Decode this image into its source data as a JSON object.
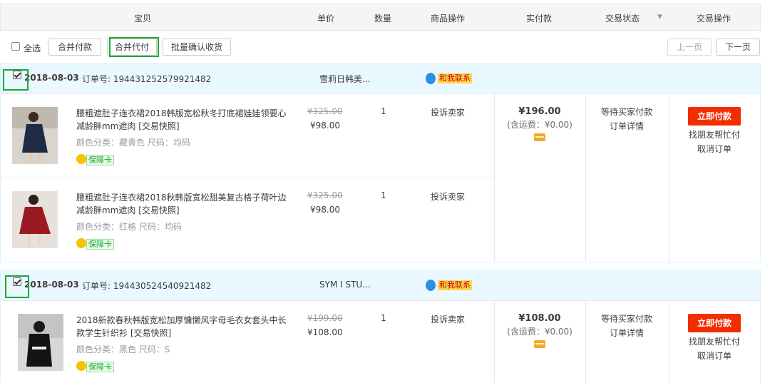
{
  "header": {
    "baby": "宝贝",
    "unit_price": "单价",
    "quantity": "数量",
    "product_ops": "商品操作",
    "paid": "实付款",
    "trade_status": "交易状态",
    "trade_ops": "交易操作"
  },
  "toolbar": {
    "select_all": "全选",
    "merge_pay": "合并付款",
    "merge_proxy_pay": "合并代付",
    "batch_confirm": "批量确认收货",
    "prev_page": "上一页",
    "next_page": "下一页"
  },
  "colors": {
    "highlight_box": "#1aa83a",
    "pay_button": "#f22e00",
    "order_header_bg": "#eaf8ff"
  },
  "orders": [
    {
      "date": "2018-08-03",
      "order_no_label": "订单号: 194431252579921482",
      "shop": "雪莉日韩美...",
      "contact": "和我联系",
      "items": [
        {
          "title": "腰粗遮肚子连衣裙2018韩版宽松秋冬打底裙娃娃领要心减龄胖mm遮肉 [交易快照]",
          "sku": "颜色分类：藏青色   尺码：均码",
          "badge": "保障卡",
          "orig_price": "¥325.00",
          "price": "¥98.00",
          "qty": "1",
          "op": "投诉卖家"
        },
        {
          "title": "腰粗遮肚子连衣裙2018秋韩版宽松甜美复古格子荷叶边减龄胖mm遮肉 [交易快照]",
          "sku": "颜色分类：红格   尺码：均码",
          "badge": "保障卡",
          "orig_price": "¥325.00",
          "price": "¥98.00",
          "qty": "1",
          "op": "投诉卖家"
        }
      ],
      "paid": "¥196.00",
      "shipping": "(含运费：¥0.00)",
      "status": "等待买家付款",
      "detail": "订单详情",
      "pay_now": "立即付款",
      "find_friend": "找朋友帮忙付",
      "cancel": "取消订单"
    },
    {
      "date": "2018-08-03",
      "order_no_label": "订单号: 194430524540921482",
      "shop": "SYM I STU...",
      "contact": "和我联系",
      "items": [
        {
          "title": "2018新款春秋韩版宽松加厚慵懒风字母毛衣女套头中长款学生针织衫 [交易快照]",
          "sku": "颜色分类：黑色   尺码：S",
          "badge": "保障卡",
          "orig_price": "¥199.00",
          "price": "¥108.00",
          "qty": "1",
          "op": "投诉卖家"
        }
      ],
      "paid": "¥108.00",
      "shipping": "(含运费：¥0.00)",
      "status": "等待买家付款",
      "detail": "订单详情",
      "pay_now": "立即付款",
      "find_friend": "找朋友帮忙付",
      "cancel": "取消订单"
    }
  ]
}
